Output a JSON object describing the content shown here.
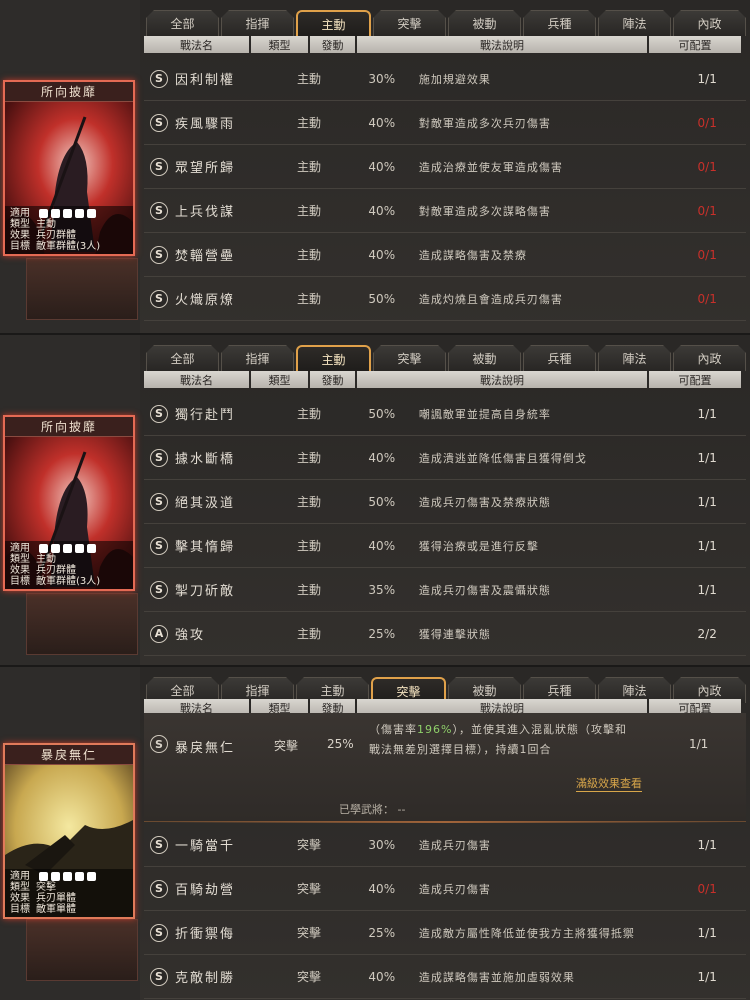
{
  "tabs": [
    "全部",
    "指揮",
    "主動",
    "突擊",
    "被動",
    "兵種",
    "陣法",
    "內政"
  ],
  "headers": {
    "name": "戰法名",
    "type": "類型",
    "trigger": "發動",
    "desc": "戰法說明",
    "config": "可配置"
  },
  "colors": {
    "accent": "#e0a14a",
    "unavailable": "#c8302a",
    "highlight": "#8fd06a"
  },
  "panel0": {
    "active_tab": 2,
    "card": {
      "title": "所向披靡",
      "labels": [
        "適用",
        "類型",
        "效果",
        "目標"
      ],
      "type": "主動",
      "effect": "兵刃群體",
      "target": "敵軍群體(3人)"
    },
    "rows": [
      {
        "badge": "S",
        "name": "因利制權",
        "type": "主動",
        "trigger": "30%",
        "desc": "施加規避效果",
        "config": "1/1",
        "red": false
      },
      {
        "badge": "S",
        "name": "疾風驟雨",
        "type": "主動",
        "trigger": "40%",
        "desc": "對敵軍造成多次兵刃傷害",
        "config": "0/1",
        "red": true
      },
      {
        "badge": "S",
        "name": "眾望所歸",
        "type": "主動",
        "trigger": "40%",
        "desc": "造成治療並使友軍造成傷害",
        "config": "0/1",
        "red": true
      },
      {
        "badge": "S",
        "name": "上兵伐謀",
        "type": "主動",
        "trigger": "40%",
        "desc": "對敵軍造成多次謀略傷害",
        "config": "0/1",
        "red": true
      },
      {
        "badge": "S",
        "name": "焚輜營壘",
        "type": "主動",
        "trigger": "40%",
        "desc": "造成謀略傷害及禁療",
        "config": "0/1",
        "red": true
      },
      {
        "badge": "S",
        "name": "火熾原燎",
        "type": "主動",
        "trigger": "50%",
        "desc": "造成灼燒且會造成兵刃傷害",
        "config": "0/1",
        "red": true
      }
    ]
  },
  "panel1": {
    "active_tab": 2,
    "card": {
      "title": "所向披靡",
      "labels": [
        "適用",
        "類型",
        "效果",
        "目標"
      ],
      "type": "主動",
      "effect": "兵刃群體",
      "target": "敵軍群體(3人)"
    },
    "rows": [
      {
        "badge": "S",
        "name": "獨行赴鬥",
        "type": "主動",
        "trigger": "50%",
        "desc": "嘲諷敵軍並提高自身統率",
        "config": "1/1",
        "red": false
      },
      {
        "badge": "S",
        "name": "據水斷橋",
        "type": "主動",
        "trigger": "40%",
        "desc": "造成潰逃並降低傷害且獲得倒戈",
        "config": "1/1",
        "red": false
      },
      {
        "badge": "S",
        "name": "絕其汲道",
        "type": "主動",
        "trigger": "50%",
        "desc": "造成兵刃傷害及禁療狀態",
        "config": "1/1",
        "red": false
      },
      {
        "badge": "S",
        "name": "擊其惰歸",
        "type": "主動",
        "trigger": "40%",
        "desc": "獲得治療或是進行反擊",
        "config": "1/1",
        "red": false
      },
      {
        "badge": "S",
        "name": "掣刀斫敵",
        "type": "主動",
        "trigger": "35%",
        "desc": "造成兵刃傷害及震懾狀態",
        "config": "1/1",
        "red": false
      },
      {
        "badge": "A",
        "name": "強攻",
        "type": "主動",
        "trigger": "25%",
        "desc": "獲得連擊狀態",
        "config": "2/2",
        "red": false
      }
    ]
  },
  "panel2": {
    "active_tab": 3,
    "card": {
      "title": "暴戾無仁",
      "labels": [
        "適用",
        "類型",
        "效果",
        "目標"
      ],
      "type": "突擊",
      "effect": "兵刃單體",
      "target": "敵軍單體"
    },
    "expanded": {
      "badge": "S",
      "name": "暴戾無仁",
      "type": "突擊",
      "trigger": "25%",
      "config": "1/1",
      "desc1_a": "（傷害率",
      "desc1_hl": "196%",
      "desc1_b": "），並使其進入混亂狀態（攻擊和",
      "desc2": "戰法無差別選擇目標），持續1回合",
      "full_effect": "滿級效果查看",
      "learned": "已學武將：  --"
    },
    "rows": [
      {
        "badge": "S",
        "name": "一騎當千",
        "type": "突擊",
        "trigger": "30%",
        "desc": "造成兵刃傷害",
        "config": "1/1",
        "red": false
      },
      {
        "badge": "S",
        "name": "百騎劫營",
        "type": "突擊",
        "trigger": "40%",
        "desc": "造成兵刃傷害",
        "config": "0/1",
        "red": true
      },
      {
        "badge": "S",
        "name": "折衝禦侮",
        "type": "突擊",
        "trigger": "25%",
        "desc": "造成敵方屬性降低並使我方主將獲得抵禦",
        "config": "1/1",
        "red": false
      },
      {
        "badge": "S",
        "name": "克敵制勝",
        "type": "突擊",
        "trigger": "40%",
        "desc": "造成謀略傷害並施加虛弱效果",
        "config": "1/1",
        "red": false
      }
    ]
  }
}
